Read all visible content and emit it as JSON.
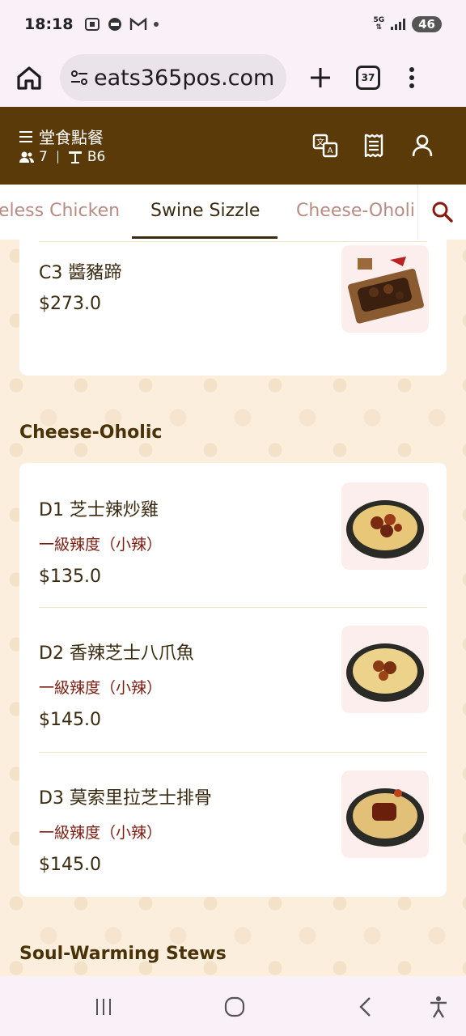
{
  "status_bar": {
    "time": "18:18",
    "network": "5G",
    "battery": "46"
  },
  "browser": {
    "url": "eats365pos.com",
    "tabs_count": "37"
  },
  "header": {
    "order_mode": "堂食點餐",
    "guests": "7",
    "table": "B6"
  },
  "category_tabs": [
    {
      "label": "eless Chicken"
    },
    {
      "label": "Swine Sizzle"
    },
    {
      "label": "Cheese-Oholi"
    }
  ],
  "items_top": [
    {
      "name": "C3 醬豬蹄",
      "price": "$273.0"
    }
  ],
  "sections": [
    {
      "title": "Cheese-Oholic",
      "items": [
        {
          "name": "D1 芝士辣炒雞",
          "spice": "一級辣度（小辣）",
          "price": "$135.0"
        },
        {
          "name": "D2 香辣芝士八爪魚",
          "spice": "一級辣度（小辣）",
          "price": "$145.0"
        },
        {
          "name": "D3 莫索里拉芝士排骨",
          "spice": "一級辣度（小辣）",
          "price": "$145.0"
        }
      ]
    },
    {
      "title": "Soul-Warming Stews"
    }
  ],
  "colors": {
    "header_bg": "#5a3a08",
    "accent_dark": "#3a2a10",
    "spice_red": "#7a1c10",
    "page_bg": "#fbeedd"
  }
}
